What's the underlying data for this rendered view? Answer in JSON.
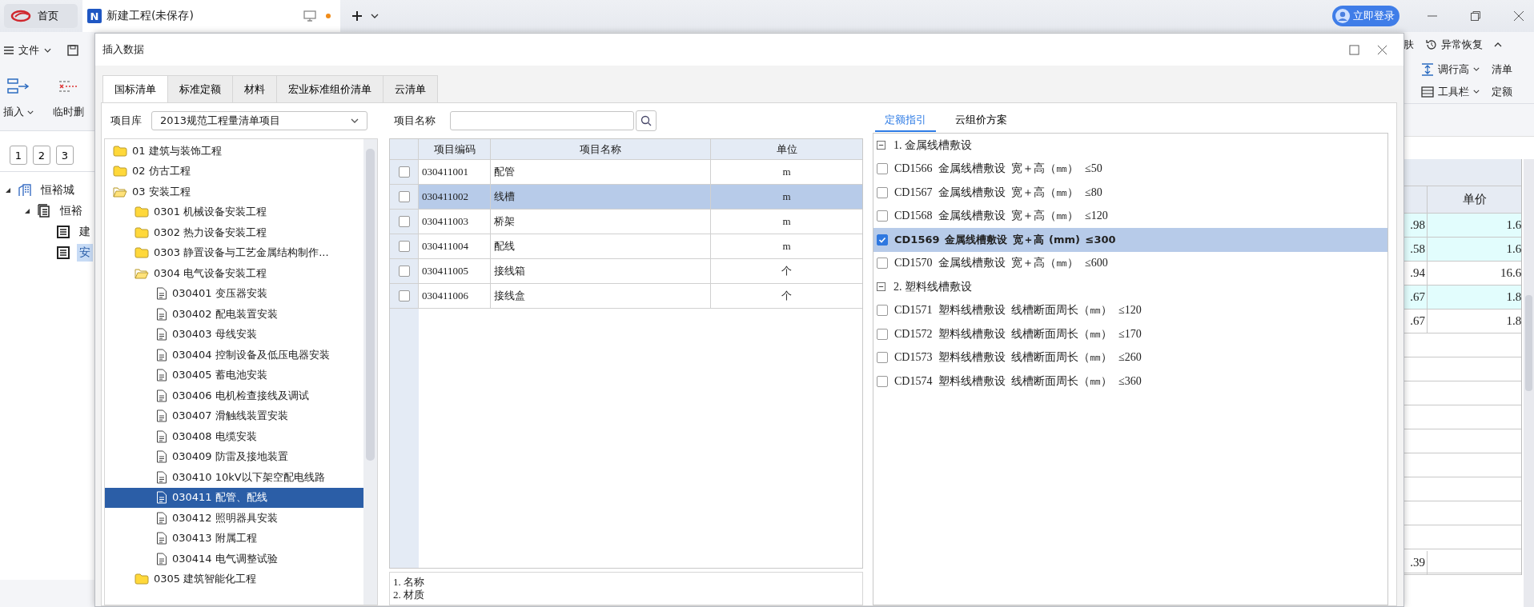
{
  "app": {
    "home_tab": "首页",
    "doc_tab": {
      "logo": "N",
      "title": "新建工程(未保存)",
      "unsaved": true
    },
    "login_button": "立即登录"
  },
  "toolbar": {
    "file_menu": "文件",
    "insert": "插入",
    "temp_delete": "临时删",
    "skin": "肤",
    "recover": "异常恢复",
    "row_height": "调行高",
    "list": "清单",
    "tool_bar": "工具栏",
    "quota": "定额"
  },
  "page_buttons": [
    "1",
    "2",
    "3"
  ],
  "project_tree": [
    {
      "label": "恒裕城",
      "kind": "project",
      "expanded": true,
      "selected": false,
      "children": [
        {
          "label": "恒裕",
          "kind": "unit",
          "expanded": true,
          "selected": false,
          "children": [
            {
              "label": "建",
              "kind": "file",
              "selected": false
            },
            {
              "label": "安",
              "kind": "file",
              "selected": true
            }
          ]
        }
      ]
    }
  ],
  "background_table": {
    "header": "单价",
    "rows": [
      {
        "col_1": ".98",
        "col_2": "1.6",
        "highlighted": true
      },
      {
        "col_1": ".58",
        "col_2": "1.6",
        "highlighted": true
      },
      {
        "col_1": ".94",
        "col_2": "16.6",
        "highlighted": false
      },
      {
        "col_1": ".67",
        "col_2": "1.8",
        "highlighted": true
      },
      {
        "col_1": ".67",
        "col_2": "1.8",
        "highlighted": false
      },
      {
        "col_1": ".39"
      }
    ]
  },
  "dialog": {
    "title": "插入数据",
    "tabs": [
      {
        "label": "国标清单",
        "selected": true
      },
      {
        "label": "标准定额",
        "selected": false
      },
      {
        "label": "材料",
        "selected": false
      },
      {
        "label": "宏业标准组价清单",
        "selected": false
      },
      {
        "label": "云清单",
        "selected": false
      }
    ],
    "library": {
      "label": "项目库",
      "value": "2013规范工程量清单项目"
    },
    "tree": [
      {
        "label": "01 建筑与装饰工程",
        "kind": "folder",
        "expanded": false,
        "selected": false
      },
      {
        "label": "02 仿古工程",
        "kind": "folder",
        "expanded": false,
        "selected": false
      },
      {
        "label": "03 安装工程",
        "kind": "folder",
        "expanded": true,
        "selected": false,
        "children": [
          {
            "label": "0301 机械设备安装工程",
            "kind": "folder",
            "expanded": false,
            "selected": false
          },
          {
            "label": "0302 热力设备安装工程",
            "kind": "folder",
            "expanded": false,
            "selected": false
          },
          {
            "label": "0303 静置设备与工艺金属结构制作...",
            "kind": "folder",
            "expanded": false,
            "selected": false
          },
          {
            "label": "0304 电气设备安装工程",
            "kind": "folder",
            "expanded": true,
            "selected": false,
            "children": [
              {
                "label": "030401 变压器安装",
                "kind": "doc",
                "selected": false
              },
              {
                "label": "030402 配电装置安装",
                "kind": "doc",
                "selected": false
              },
              {
                "label": "030403 母线安装",
                "kind": "doc",
                "selected": false
              },
              {
                "label": "030404 控制设备及低压电器安装",
                "kind": "doc",
                "selected": false
              },
              {
                "label": "030405 蓄电池安装",
                "kind": "doc",
                "selected": false
              },
              {
                "label": "030406 电机检查接线及调试",
                "kind": "doc",
                "selected": false
              },
              {
                "label": "030407 滑触线装置安装",
                "kind": "doc",
                "selected": false
              },
              {
                "label": "030408 电缆安装",
                "kind": "doc",
                "selected": false
              },
              {
                "label": "030409 防雷及接地装置",
                "kind": "doc",
                "selected": false
              },
              {
                "label": "030410 10kV以下架空配电线路",
                "kind": "doc",
                "selected": false
              },
              {
                "label": "030411 配管、配线",
                "kind": "doc",
                "selected": true
              },
              {
                "label": "030412 照明器具安装",
                "kind": "doc",
                "selected": false
              },
              {
                "label": "030413 附属工程",
                "kind": "doc",
                "selected": false
              },
              {
                "label": "030414 电气调整试验",
                "kind": "doc",
                "selected": false
              }
            ]
          },
          {
            "label": "0305 建筑智能化工程",
            "kind": "folder",
            "expanded": false,
            "selected": false
          }
        ]
      }
    ],
    "search": {
      "label": "项目名称"
    },
    "columns": [
      "项目编码",
      "项目名称",
      "单位"
    ],
    "rows": [
      {
        "code": "030411001",
        "name": "配管",
        "unit": "m",
        "checked": false,
        "selected": false
      },
      {
        "code": "030411002",
        "name": "线槽",
        "unit": "m",
        "checked": false,
        "selected": true
      },
      {
        "code": "030411003",
        "name": "桥架",
        "unit": "m",
        "checked": false,
        "selected": false
      },
      {
        "code": "030411004",
        "name": "配线",
        "unit": "m",
        "checked": false,
        "selected": false
      },
      {
        "code": "030411005",
        "name": "接线箱",
        "unit": "个",
        "checked": false,
        "selected": false
      },
      {
        "code": "030411006",
        "name": "接线盒",
        "unit": "个",
        "checked": false,
        "selected": false
      }
    ],
    "description": [
      "1. 名称",
      "2. 材质"
    ],
    "side_tabs": [
      {
        "label": "定额指引",
        "selected": true
      },
      {
        "label": "云组价方案",
        "selected": false
      }
    ],
    "guide": [
      {
        "label": "1. 金属线槽敷设",
        "expanded": true,
        "items": [
          {
            "text": "CD1566 金属线槽敷设 宽＋高（㎜） ≤50",
            "checked": false,
            "selected": false
          },
          {
            "text": "CD1567 金属线槽敷设 宽＋高（㎜） ≤80",
            "checked": false,
            "selected": false
          },
          {
            "text": "CD1568 金属线槽敷设 宽＋高（㎜） ≤120",
            "checked": false,
            "selected": false
          },
          {
            "text": "CD1569 金属线槽敷设 宽＋高 (mm) ≤300",
            "checked": true,
            "selected": true
          },
          {
            "text": "CD1570 金属线槽敷设 宽＋高（㎜） ≤600",
            "checked": false,
            "selected": false
          }
        ]
      },
      {
        "label": "2. 塑料线槽敷设",
        "expanded": true,
        "items": [
          {
            "text": "CD1571 塑料线槽敷设 线槽断面周长（㎜） ≤120",
            "checked": false,
            "selected": false
          },
          {
            "text": "CD1572 塑料线槽敷设 线槽断面周长（㎜） ≤170",
            "checked": false,
            "selected": false
          },
          {
            "text": "CD1573 塑料线槽敷设 线槽断面周长（㎜） ≤260",
            "checked": false,
            "selected": false
          },
          {
            "text": "CD1574 塑料线槽敷设 线槽断面周长（㎜） ≤360",
            "checked": false,
            "selected": false
          }
        ]
      }
    ]
  }
}
